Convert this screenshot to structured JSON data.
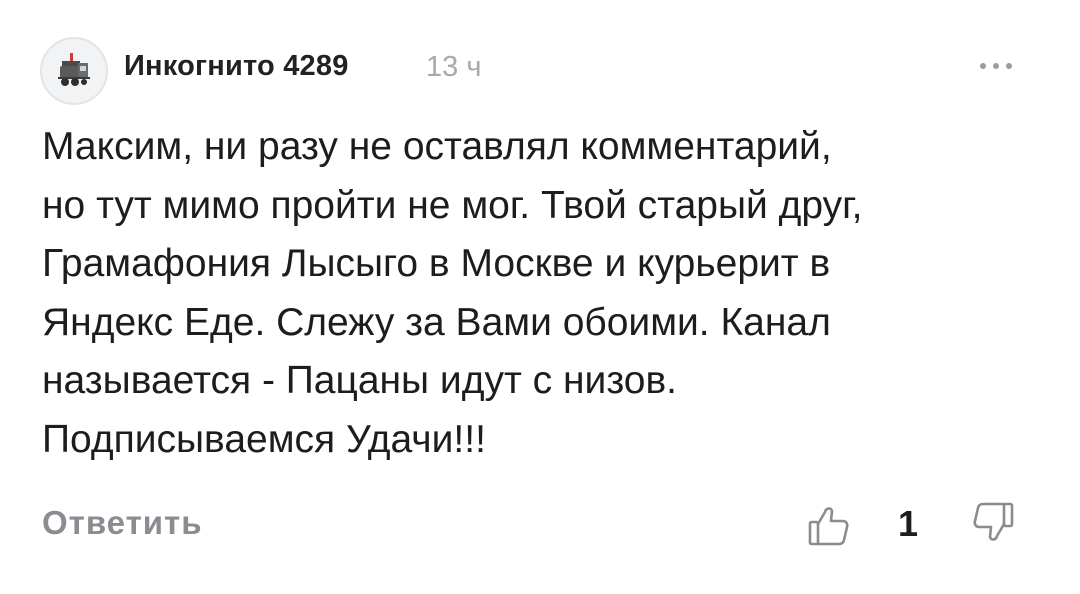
{
  "comment": {
    "author": "Инкогнито 4289",
    "time": "13 ч",
    "avatar_icon": "locomotive-icon",
    "more_icon": "more-dots-icon",
    "lines": [
      "Максим, ни разу не оставлял комментарий,",
      "но тут мимо пройти не мог. Твой старый друг,",
      "Грамафония Лысыго в Москве и курьерит в",
      "Яндекс Еде. Слежу за Вами обоими. Канал",
      "называется - Пацаны идут с низов.",
      "Подписываемся Удачи!!!"
    ],
    "reply_label": "Ответить",
    "like_icon": "thumbs-up-icon",
    "like_count": "1",
    "dislike_icon": "thumbs-down-icon"
  },
  "colors": {
    "muted": "#8a8c91",
    "time": "#a7a9ae",
    "text": "#1d1d1d"
  }
}
